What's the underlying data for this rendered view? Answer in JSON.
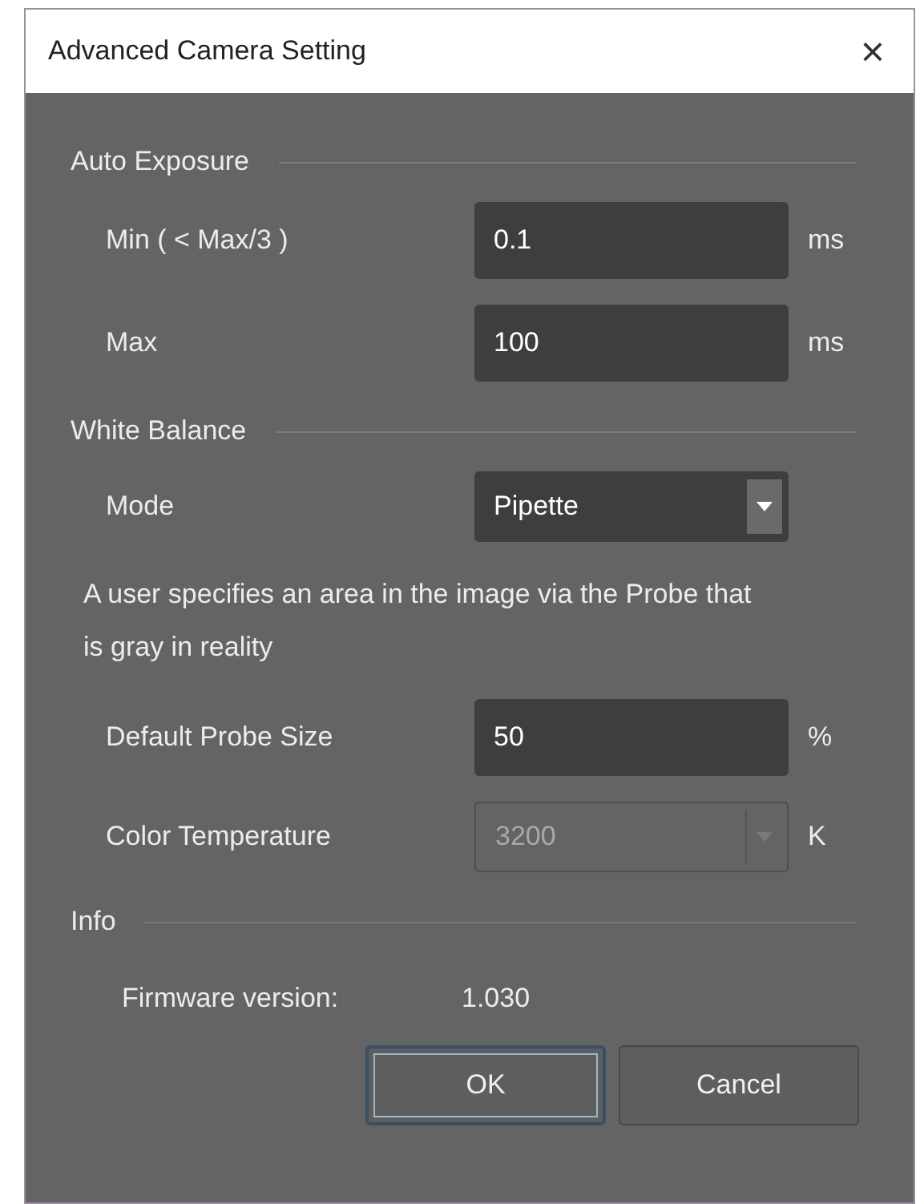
{
  "window": {
    "title": "Advanced Camera Setting",
    "close": "×"
  },
  "sections": [
    {
      "heading": "Auto Exposure",
      "rows": [
        {
          "kind": "field",
          "label": "Min ( < Max/3 )",
          "value": "0.1",
          "unit": "ms"
        },
        {
          "kind": "field",
          "label": "Max",
          "value": "100",
          "unit": "ms"
        }
      ]
    },
    {
      "heading": "White Balance",
      "rows": [
        {
          "kind": "dropdown",
          "label": "Mode",
          "value": "Pipette",
          "disabled": false
        },
        {
          "kind": "note",
          "text": "A user specifies an area in the image via the Probe that is gray in reality"
        },
        {
          "kind": "field",
          "label": "Default Probe Size",
          "value": "50",
          "unit": "%"
        },
        {
          "kind": "dropdown",
          "label": "Color Temperature",
          "value": "3200",
          "unit": "K",
          "disabled": true
        }
      ]
    },
    {
      "heading": "Info",
      "rows": [
        {
          "kind": "info",
          "label": "Firmware version:",
          "value": "1.030"
        }
      ]
    }
  ],
  "buttons": [
    {
      "label": "OK",
      "default": true
    },
    {
      "label": "Cancel",
      "default": false
    }
  ]
}
